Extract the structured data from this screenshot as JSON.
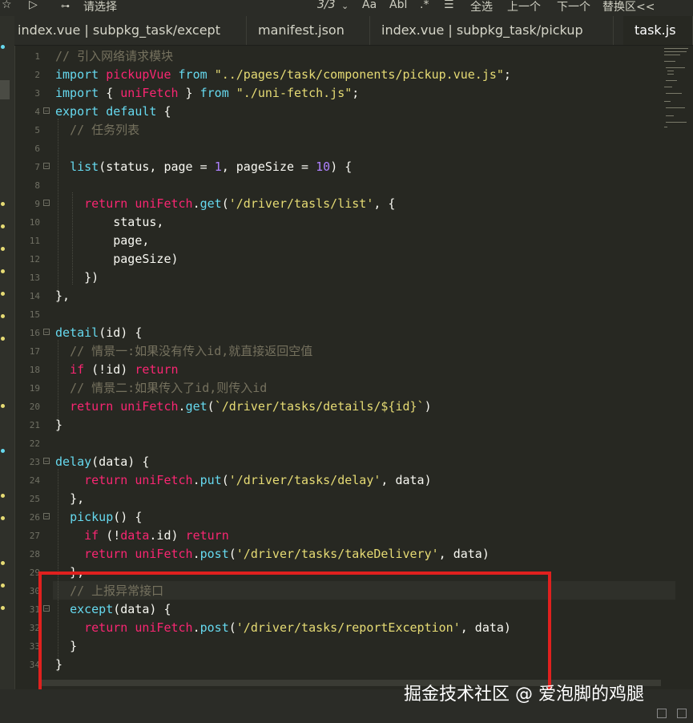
{
  "toolbar": {
    "search_placeholder": "请选择",
    "match_count": "3/3",
    "case_label": "Aa",
    "word_label": "Abl",
    "regex_label": ".*",
    "select_all_label": "全选",
    "prev_label": "上一个",
    "next_label": "下一个",
    "replace_label": "替换区<<"
  },
  "tabs": [
    {
      "label": "index.vue | subpkg_task/except"
    },
    {
      "label": "manifest.json"
    },
    {
      "label": "index.vue | subpkg_task/pickup"
    },
    {
      "label": "task.js"
    }
  ],
  "code_lines": [
    {
      "n": "1"
    },
    {
      "n": "2"
    },
    {
      "n": "3"
    },
    {
      "n": "4"
    },
    {
      "n": "5"
    },
    {
      "n": "6"
    },
    {
      "n": "7"
    },
    {
      "n": "8"
    },
    {
      "n": "9"
    },
    {
      "n": "10"
    },
    {
      "n": "11"
    },
    {
      "n": "12"
    },
    {
      "n": "13"
    },
    {
      "n": "14"
    },
    {
      "n": "15"
    },
    {
      "n": "16"
    },
    {
      "n": "17"
    },
    {
      "n": "18"
    },
    {
      "n": "19"
    },
    {
      "n": "20"
    },
    {
      "n": "21"
    },
    {
      "n": "22"
    },
    {
      "n": "23"
    },
    {
      "n": "24"
    },
    {
      "n": "25"
    },
    {
      "n": "26"
    },
    {
      "n": "27"
    },
    {
      "n": "28"
    },
    {
      "n": "29"
    },
    {
      "n": "30"
    },
    {
      "n": "31"
    },
    {
      "n": "32"
    },
    {
      "n": "33"
    },
    {
      "n": "34"
    }
  ],
  "code": {
    "l1_comment": "// 引入网络请求模块",
    "l2_import": "import",
    "l2_name": "pickupVue",
    "l2_from": "from",
    "l2_path": "\"../pages/task/components/pickup.vue.js\"",
    "l2_end": ";",
    "l3_import": "import",
    "l3_brace_open": "{ ",
    "l3_name": "uniFetch",
    "l3_brace_close": " }",
    "l3_from": "from",
    "l3_path": "\"./uni-fetch.js\"",
    "l3_end": ";",
    "l4_export": "export",
    "l4_default": "default",
    "l4_brace": "{",
    "l5_comment": "// 任务列表",
    "l7_fn": "list",
    "l7_params_a": "(status, page = ",
    "l7_one": "1",
    "l7_params_b": ", pageSize = ",
    "l7_ten": "10",
    "l7_params_c": ") {",
    "l9_return": "return",
    "l9_obj": "uniFetch",
    "l9_dot": ".",
    "l9_method": "get",
    "l9_open": "(",
    "l9_str": "'/driver/tasls/list'",
    "l9_tail": ", {",
    "l10": "status,",
    "l11": "page,",
    "l12": "pageSize)",
    "l13": "})",
    "l14": "},",
    "l16_fn": "detail",
    "l16_rest": "(id) {",
    "l17_comment": "// 情景一:如果没有传入id,就直接返回空值",
    "l18_if": "if",
    "l18_cond": " (!id) ",
    "l18_return": "return",
    "l19_comment": "// 情景二:如果传入了id,则传入id",
    "l20_return": "return",
    "l20_obj": "uniFetch",
    "l20_dot": ".",
    "l20_method": "get",
    "l20_open": "(",
    "l20_str": "`/driver/tasks/details/${id}`",
    "l20_close": ")",
    "l21": "}",
    "l23_fn": "delay",
    "l23_rest": "(data) {",
    "l24_return": "return",
    "l24_obj": "uniFetch",
    "l24_dot": ".",
    "l24_method": "put",
    "l24_open": "(",
    "l24_str": "'/driver/tasks/delay'",
    "l24_tail": ", data)",
    "l25": "},",
    "l26_fn": "pickup",
    "l26_rest": "() {",
    "l27_if": "if",
    "l27_cond_a": " (!",
    "l27_data": "data",
    "l27_cond_b": ".id) ",
    "l27_return": "return",
    "l28_return": "return",
    "l28_obj": "uniFetch",
    "l28_dot": ".",
    "l28_method": "post",
    "l28_open": "(",
    "l28_str": "'/driver/tasks/takeDelivery'",
    "l28_tail": ", data)",
    "l29": "},",
    "l30_comment": "// 上报异常接口",
    "l31_fn": "except",
    "l31_rest": "(data) {",
    "l32_return": "return",
    "l32_obj": "uniFetch",
    "l32_dot": ".",
    "l32_method": "post",
    "l32_open": "(",
    "l32_str": "'/driver/tasks/reportException'",
    "l32_tail": ", data)",
    "l33": "}",
    "l34": "}"
  },
  "watermark": "掘金技术社区 @ 爱泡脚的鸡腿",
  "colors": {
    "background": "#272822",
    "keyword": "#66d9ef",
    "string": "#e6db74",
    "comment": "#75715e",
    "number": "#ae81ff",
    "function": "#a6e22e",
    "highlight_box": "#e0201e"
  }
}
